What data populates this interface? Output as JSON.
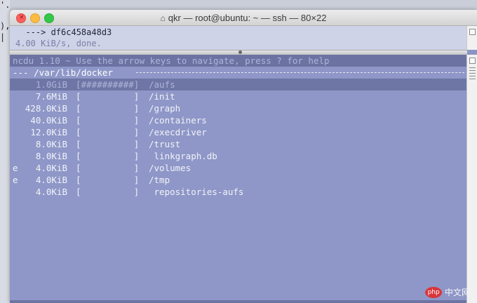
{
  "background": {
    "fragments": [
      "'.",
      "),",
      "|"
    ]
  },
  "window": {
    "title": "qkr — root@ubuntu: ~ — ssh — 80×22",
    "home_icon": "⌂"
  },
  "upper_pane": {
    "line1": "  ---> df6c458a48d3",
    "line2": "4.00 KiB/s, done."
  },
  "ncdu": {
    "header": "ncdu 1.10 ~ Use the arrow keys to navigate, press ? for help",
    "path": "--- /var/lib/docker ",
    "rows": [
      {
        "flag": "",
        "size": "1.0GiB",
        "bar": "[##########]",
        "name": "/aufs"
      },
      {
        "flag": "",
        "size": "7.6MiB",
        "bar": "[          ]",
        "name": "/init"
      },
      {
        "flag": "",
        "size": "428.0KiB",
        "bar": "[          ]",
        "name": "/graph"
      },
      {
        "flag": "",
        "size": "40.0KiB",
        "bar": "[          ]",
        "name": "/containers"
      },
      {
        "flag": "",
        "size": "12.0KiB",
        "bar": "[          ]",
        "name": "/execdriver"
      },
      {
        "flag": "",
        "size": "8.0KiB",
        "bar": "[          ]",
        "name": "/trust"
      },
      {
        "flag": "",
        "size": "8.0KiB",
        "bar": "[          ]",
        "name": " linkgraph.db"
      },
      {
        "flag": "e",
        "size": "4.0KiB",
        "bar": "[          ]",
        "name": "/volumes"
      },
      {
        "flag": "e",
        "size": "4.0KiB",
        "bar": "[          ]",
        "name": "/tmp"
      },
      {
        "flag": "",
        "size": "4.0KiB",
        "bar": "[          ]",
        "name": " repositories-aufs"
      }
    ]
  },
  "watermark": {
    "logo": "php",
    "text": "中文网"
  },
  "colors": {
    "terminal_bg": "#8e97c7",
    "selection_bg": "#6e76a6",
    "close": "#fc605c",
    "minimize": "#fdbc40",
    "maximize": "#34c84a"
  }
}
